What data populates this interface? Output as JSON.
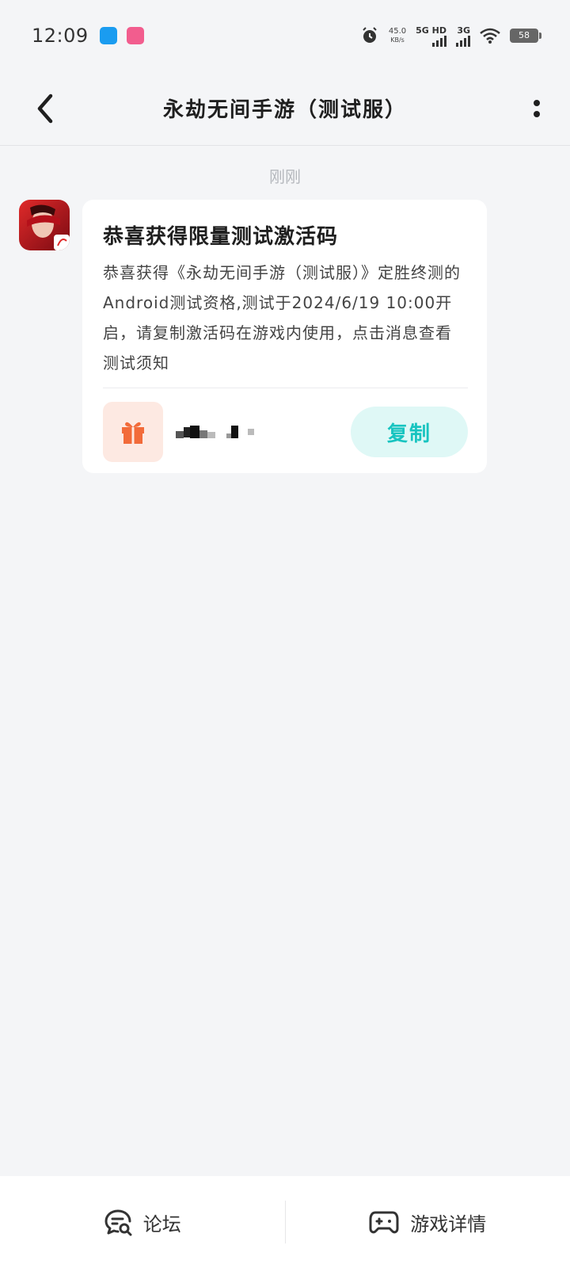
{
  "status_bar": {
    "time": "12:09",
    "net_speed": "45.0",
    "net_speed_unit": "KB/s",
    "net_5g": "5G HD",
    "net_3g": "3G",
    "battery": "58"
  },
  "nav": {
    "title": "永劫无间手游（测试服）"
  },
  "chat": {
    "timestamp": "刚刚",
    "card": {
      "title": "恭喜获得限量测试激活码",
      "body": "恭喜获得《永劫无间手游（测试服）》定胜终测的Android测试资格,测试于2024/6/19 10:00开启，请复制激活码在游戏内使用，点击消息查看测试须知",
      "copy_label": "复制"
    }
  },
  "bottom_bar": {
    "forum_label": "论坛",
    "game_detail_label": "游戏详情"
  },
  "colors": {
    "accent": "#18c4c0",
    "copy_bg": "#dff8f6",
    "gift": "#f26b3a",
    "gift_bg": "#fde9e2",
    "page_bg": "#f4f5f7"
  }
}
